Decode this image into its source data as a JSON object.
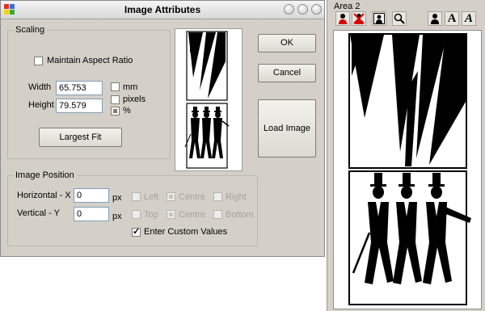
{
  "dialog": {
    "title": "Image Attributes",
    "scaling": {
      "legend": "Scaling",
      "maintain_aspect_label": "Maintain Aspect Ratio",
      "width_label": "Width",
      "width_value": "65.753",
      "height_label": "Height",
      "height_value": "79.579",
      "units": [
        "mm",
        "pixels",
        "%"
      ],
      "largest_fit_label": "Largest Fit"
    },
    "buttons": {
      "ok": "OK",
      "cancel": "Cancel",
      "load_image": "Load Image"
    },
    "position": {
      "legend": "Image Position",
      "horizontal_label": "Horizontal - X",
      "horizontal_value": "0",
      "vertical_label": "Vertical - Y",
      "vertical_value": "0",
      "unit": "px",
      "h_options": [
        "Left",
        "Centre",
        "Right"
      ],
      "v_options": [
        "Top",
        "Centre",
        "Bottom"
      ],
      "custom_label": "Enter Custom Values",
      "custom_checked": true
    }
  },
  "panel": {
    "title": "Area 2",
    "tools": [
      "person-red-icon",
      "person-red-x-icon",
      "person-frame-icon",
      "magnifier-icon",
      "person-icon",
      "text-a-icon",
      "text-a-italic-icon"
    ]
  }
}
